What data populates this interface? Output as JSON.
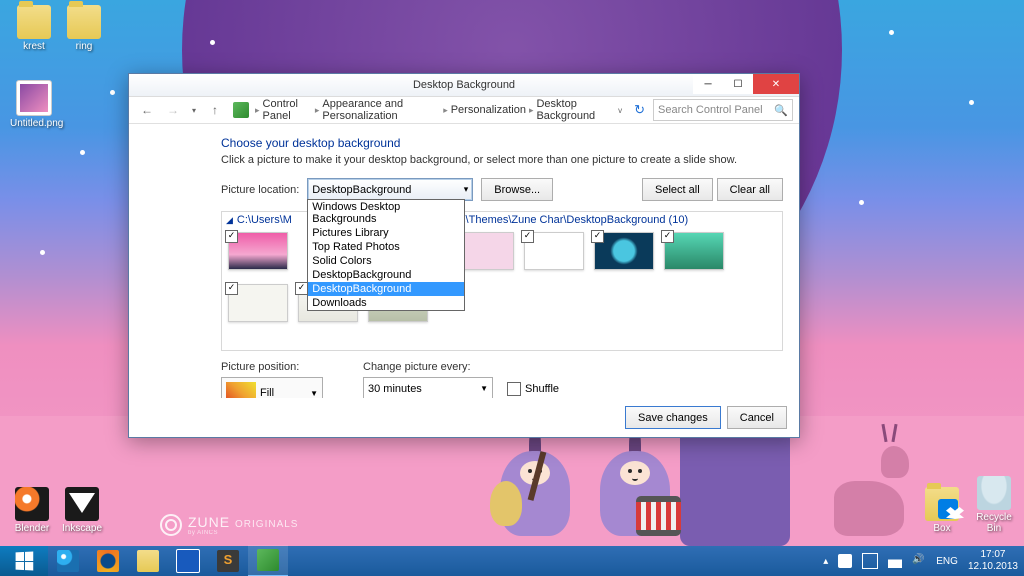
{
  "desktop_icons": {
    "krest": "krest",
    "ring": "ring",
    "untitled": "Untitled.png",
    "blender": "Blender",
    "inkscape": "Inkscape",
    "box": "Box",
    "recycle": "Recycle Bin"
  },
  "zune": {
    "brand": "ZUNE",
    "sub1": "ORIGINALS",
    "sub2": "by AINCS"
  },
  "window": {
    "title": "Desktop Background",
    "breadcrumbs": {
      "root": "Control Panel",
      "l1": "Appearance and Personalization",
      "l2": "Personalization",
      "l3": "Desktop Background"
    },
    "search_placeholder": "Search Control Panel",
    "heading": "Choose your desktop background",
    "subtext": "Click a picture to make it your desktop background, or select more than one picture to create a slide show.",
    "picloc_label": "Picture location:",
    "picloc_selected": "DesktopBackground",
    "picloc_options": [
      "Windows Desktop Backgrounds",
      "Pictures Library",
      "Top Rated Photos",
      "Solid Colors",
      "DesktopBackground",
      "DesktopBackground",
      "Downloads"
    ],
    "browse": "Browse...",
    "select_all": "Select all",
    "clear_all": "Clear all",
    "folder1": "C:\\Users\\M",
    "folder2": "ows\\Themes\\Zune Char\\DesktopBackground (10)",
    "picpos_label": "Picture position:",
    "picpos_value": "Fill",
    "change_label": "Change picture every:",
    "change_value": "30 minutes",
    "shuffle": "Shuffle",
    "save": "Save changes",
    "cancel": "Cancel"
  },
  "taskbar": {
    "lang": "ENG",
    "time": "17:07",
    "date": "12.10.2013"
  }
}
